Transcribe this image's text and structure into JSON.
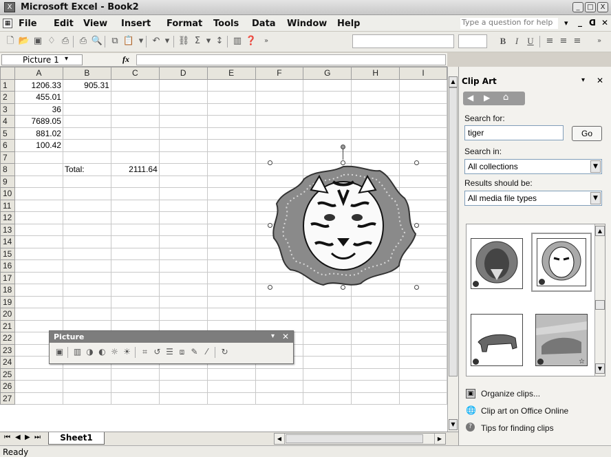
{
  "window": {
    "title": "Microsoft Excel - Book2",
    "controls": [
      "_",
      "□",
      "X"
    ]
  },
  "menu": {
    "items": [
      "File",
      "Edit",
      "View",
      "Insert",
      "Format",
      "Tools",
      "Data",
      "Window",
      "Help"
    ],
    "help_placeholder": "Type a question for help"
  },
  "formula_bar": {
    "name_box": "Picture 1",
    "fx": "fx"
  },
  "sheet": {
    "columns": [
      "A",
      "B",
      "C",
      "D",
      "E",
      "F",
      "G",
      "H",
      "I"
    ],
    "rows": [
      {
        "n": "1",
        "A": "1206.33",
        "B": "905.31",
        "C": ""
      },
      {
        "n": "2",
        "A": "455.01",
        "B": "",
        "C": ""
      },
      {
        "n": "3",
        "A": "36",
        "B": "",
        "C": ""
      },
      {
        "n": "4",
        "A": "7689.05",
        "B": "",
        "C": ""
      },
      {
        "n": "5",
        "A": "881.02",
        "B": "",
        "C": ""
      },
      {
        "n": "6",
        "A": "100.42",
        "B": "",
        "C": ""
      },
      {
        "n": "7",
        "A": "",
        "B": "",
        "C": ""
      },
      {
        "n": "8",
        "A": "",
        "B": "Total:",
        "C": "2111.64"
      },
      {
        "n": "9"
      },
      {
        "n": "10"
      },
      {
        "n": "11"
      },
      {
        "n": "12"
      },
      {
        "n": "13"
      },
      {
        "n": "14"
      },
      {
        "n": "15"
      },
      {
        "n": "16"
      },
      {
        "n": "17"
      },
      {
        "n": "18"
      },
      {
        "n": "19"
      },
      {
        "n": "20"
      },
      {
        "n": "21"
      },
      {
        "n": "22"
      },
      {
        "n": "23"
      },
      {
        "n": "24"
      },
      {
        "n": "25"
      },
      {
        "n": "26"
      },
      {
        "n": "27"
      }
    ],
    "tab": "Sheet1"
  },
  "status": {
    "text": "Ready"
  },
  "picture_toolbar": {
    "title": "Picture"
  },
  "clip_art_pane": {
    "title": "Clip Art",
    "search_for_label": "Search for:",
    "search_value": "tiger",
    "go_label": "Go",
    "search_in_label": "Search in:",
    "search_in_value": "All collections",
    "results_label": "Results should be:",
    "results_value": "All media file types",
    "links": [
      "Organize clips...",
      "Clip art on Office Online",
      "Tips for finding clips"
    ]
  },
  "colors": {
    "title_bar": "#d4d4d4",
    "picture_toolbar_header": "#7d7d7d",
    "tiger_frame": "#8a8a8a"
  }
}
